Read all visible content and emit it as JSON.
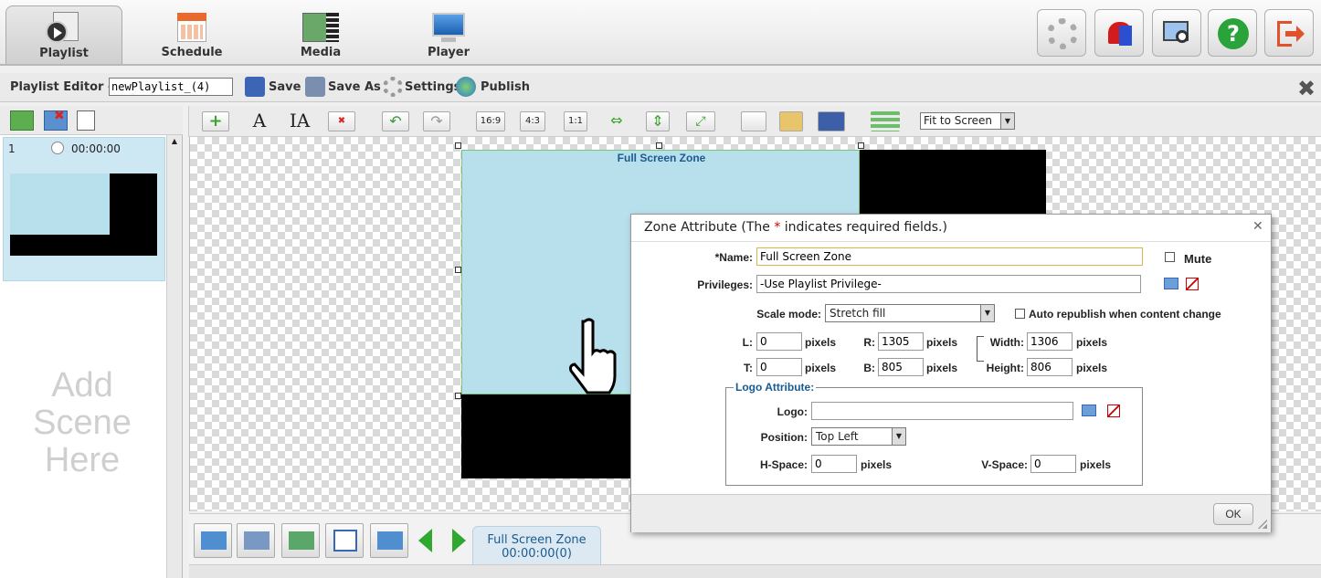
{
  "nav": {
    "tabs": [
      {
        "label": "Playlist",
        "icon": "playlist-icon",
        "active": true
      },
      {
        "label": "Schedule",
        "icon": "calendar-icon"
      },
      {
        "label": "Media",
        "icon": "media-film-icon"
      },
      {
        "label": "Player",
        "icon": "monitor-icon"
      }
    ],
    "tools": [
      {
        "icon": "gear-icon"
      },
      {
        "icon": "alarm-light-icon"
      },
      {
        "icon": "screen-search-icon"
      },
      {
        "icon": "help-icon"
      },
      {
        "icon": "logout-icon"
      }
    ]
  },
  "editor": {
    "title": "Playlist Editor -",
    "playlist_name": "newPlaylist_(4)",
    "save": "Save",
    "save_as": "Save As",
    "settings": "Settings",
    "publish": "Publish"
  },
  "scenes": {
    "items": [
      {
        "index": "1",
        "duration": "00:00:00"
      }
    ],
    "add_hint": "Add Scene Here"
  },
  "toolbar": {
    "ratios": [
      "16:9",
      "4:3",
      "1:1"
    ],
    "fit_option": "Fit to Screen"
  },
  "canvas": {
    "zone_label": "Full Screen Zone"
  },
  "bottom": {
    "scene_tab_name": "Full Screen Zone",
    "scene_tab_time": "00:00:00(0)"
  },
  "dialog": {
    "title_prefix": "Zone Attribute (The ",
    "title_star": "*",
    "title_suffix": " indicates required fields.)",
    "name_label": "*Name:",
    "name_value": "Full Screen Zone",
    "mute_label": "Mute",
    "privileges_label": "Privileges:",
    "privileges_value": "-Use Playlist Privilege-",
    "scale_label": "Scale mode:",
    "scale_value": "Stretch fill",
    "auto_label": "Auto republish when content change",
    "l_label": "L:",
    "l_value": "0",
    "r_label": "R:",
    "r_value": "1305",
    "width_label": "Width:",
    "width_value": "1306",
    "t_label": "T:",
    "t_value": "0",
    "b_label": "B:",
    "b_value": "805",
    "height_label": "Height:",
    "height_value": "806",
    "pixels": "pixels",
    "logo_group": "Logo Attribute:",
    "logo_label": "Logo:",
    "logo_value": "",
    "position_label": "Position:",
    "position_value": "Top Left",
    "hspace_label": "H-Space:",
    "hspace_value": "0",
    "vspace_label": "V-Space:",
    "vspace_value": "0",
    "ok": "OK"
  },
  "colors": {
    "zone": "#b8dfec",
    "accent": "#1a5b8f",
    "required": "#d00000"
  }
}
